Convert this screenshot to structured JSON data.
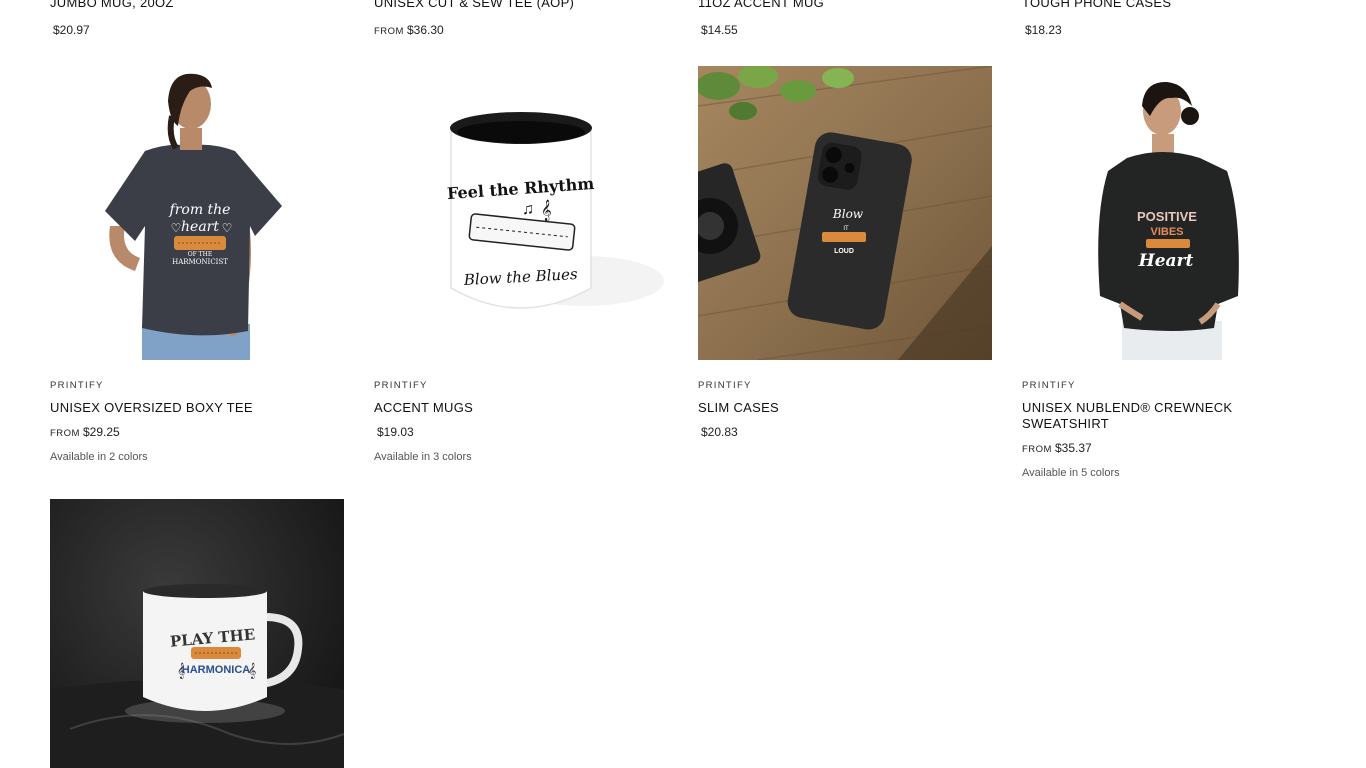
{
  "top_row": [
    {
      "title": "JUMBO MUG, 20OZ",
      "price": "$20.97",
      "from": ""
    },
    {
      "title": "UNISEX CUT & SEW TEE (AOP)",
      "price": "$36.30",
      "from": "FROM"
    },
    {
      "title": "11OZ ACCENT MUG",
      "price": "$14.55",
      "from": ""
    },
    {
      "title": "TOUGH PHONE CASES",
      "price": "$18.23",
      "from": ""
    }
  ],
  "products": [
    {
      "vendor": "PRINTIFY",
      "title": "UNISEX OVERSIZED BOXY TEE",
      "from": "FROM",
      "price": "$29.25",
      "colors": "Available in 2 colors",
      "art": {
        "line1": "from the",
        "line2": "heart",
        "line3": "OF THE",
        "line4": "HARMONICIST"
      }
    },
    {
      "vendor": "PRINTIFY",
      "title": "ACCENT MUGS",
      "from": "",
      "price": "$19.03",
      "colors": "Available in 3 colors",
      "art": {
        "line1": "Feel the Rhythm",
        "line2": "Blow the Blues"
      }
    },
    {
      "vendor": "PRINTIFY",
      "title": "SLIM CASES",
      "from": "",
      "price": "$20.83",
      "colors": "",
      "art": {
        "line1": "Blow",
        "line2": "IT",
        "line3": "LOUD"
      }
    },
    {
      "vendor": "PRINTIFY",
      "title": "UNISEX NUBLEND® CREWNECK SWEATSHIRT",
      "from": "FROM",
      "price": "$35.37",
      "colors": "Available in 5 colors",
      "art": {
        "line1": "POSITIVE",
        "line2": "VIBES",
        "line3": "Heart"
      }
    },
    {
      "art": {
        "line1": "PLAY THE",
        "line2": "HARMONICA"
      }
    }
  ],
  "colors": {
    "shirt": "#3b3e47",
    "sweatshirt": "#222524",
    "harmonica": "#d98a3d",
    "harmonica_blue": "#2b4f8f"
  }
}
